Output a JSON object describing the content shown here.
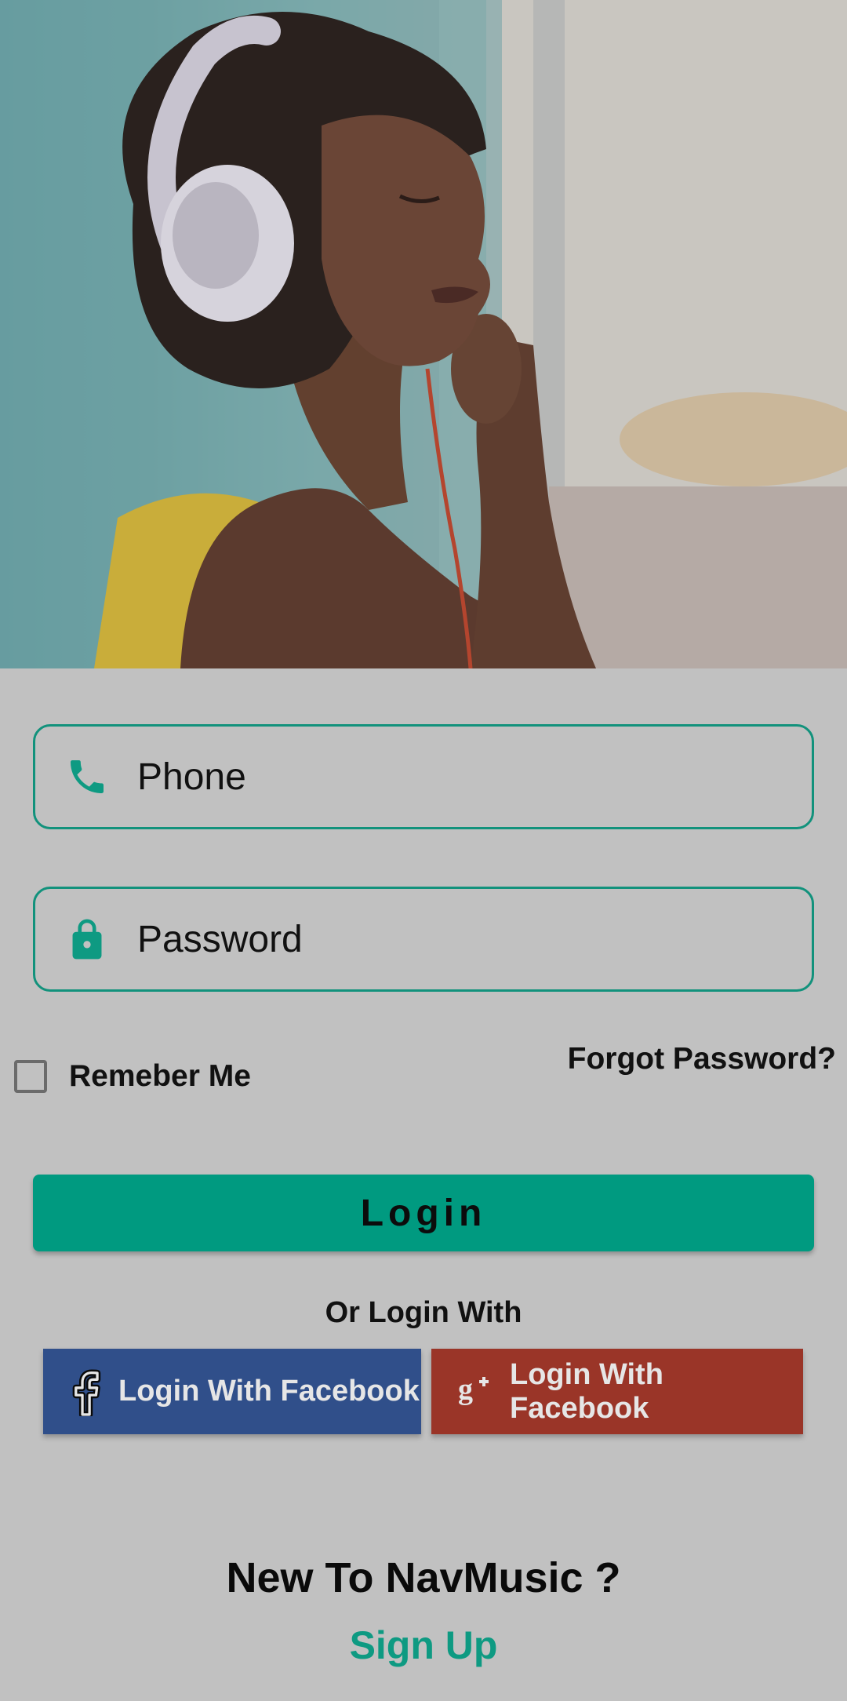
{
  "hero": {
    "image": "woman-listening-with-headphones"
  },
  "form": {
    "phone_placeholder": "Phone",
    "password_placeholder": "Password",
    "remember_label": "Remeber Me",
    "remember_checked": false,
    "forgot_label": "Forgot Password?",
    "login_label": "Login"
  },
  "social": {
    "or_label": "Or Login With",
    "facebook_label": "Login With Facebook",
    "google_label": "Login With Facebook"
  },
  "footer": {
    "new_to_label": "New To NavMusic ?",
    "signup_label": "Sign Up"
  },
  "colors": {
    "accent": "#009a80",
    "facebook": "#304f8a",
    "google": "#9a3528",
    "background": "#c1c1c1"
  },
  "icons": [
    "phone-icon",
    "lock-icon",
    "facebook-icon",
    "google-plus-icon"
  ]
}
